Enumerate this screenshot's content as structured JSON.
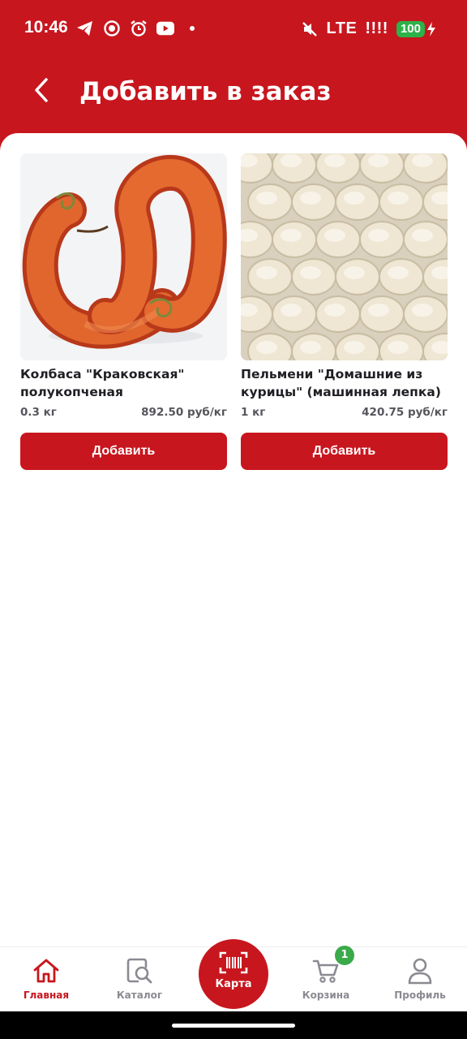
{
  "status_bar": {
    "time": "10:46",
    "network": "LTE",
    "signal": "!!!!",
    "battery": "100",
    "icons": [
      "telegram-icon",
      "record-icon",
      "alarm-icon",
      "youtube-icon",
      "dot-icon",
      "mute-icon",
      "charging-icon"
    ]
  },
  "header": {
    "title": "Добавить в заказ",
    "back_icon": "chevron-left-icon"
  },
  "products": [
    {
      "name": "Колбаса \"Краковская\" полукопченая",
      "weight": "0.3 кг",
      "price": "892.50 руб/кг",
      "add_label": "Добавить"
    },
    {
      "name": "Пельмени \"Домашние из курицы\" (машинная лепка)",
      "weight": "1 кг",
      "price": "420.75 руб/кг",
      "add_label": "Добавить"
    }
  ],
  "bottom_nav": {
    "home": "Главная",
    "catalog": "Каталог",
    "card": "Карта",
    "cart": "Корзина",
    "cart_badge": "1",
    "profile": "Профиль",
    "active": "home"
  },
  "colors": {
    "brand_red": "#c8161e",
    "badge_green": "#3aaa4a",
    "battery_green": "#2db24a"
  }
}
